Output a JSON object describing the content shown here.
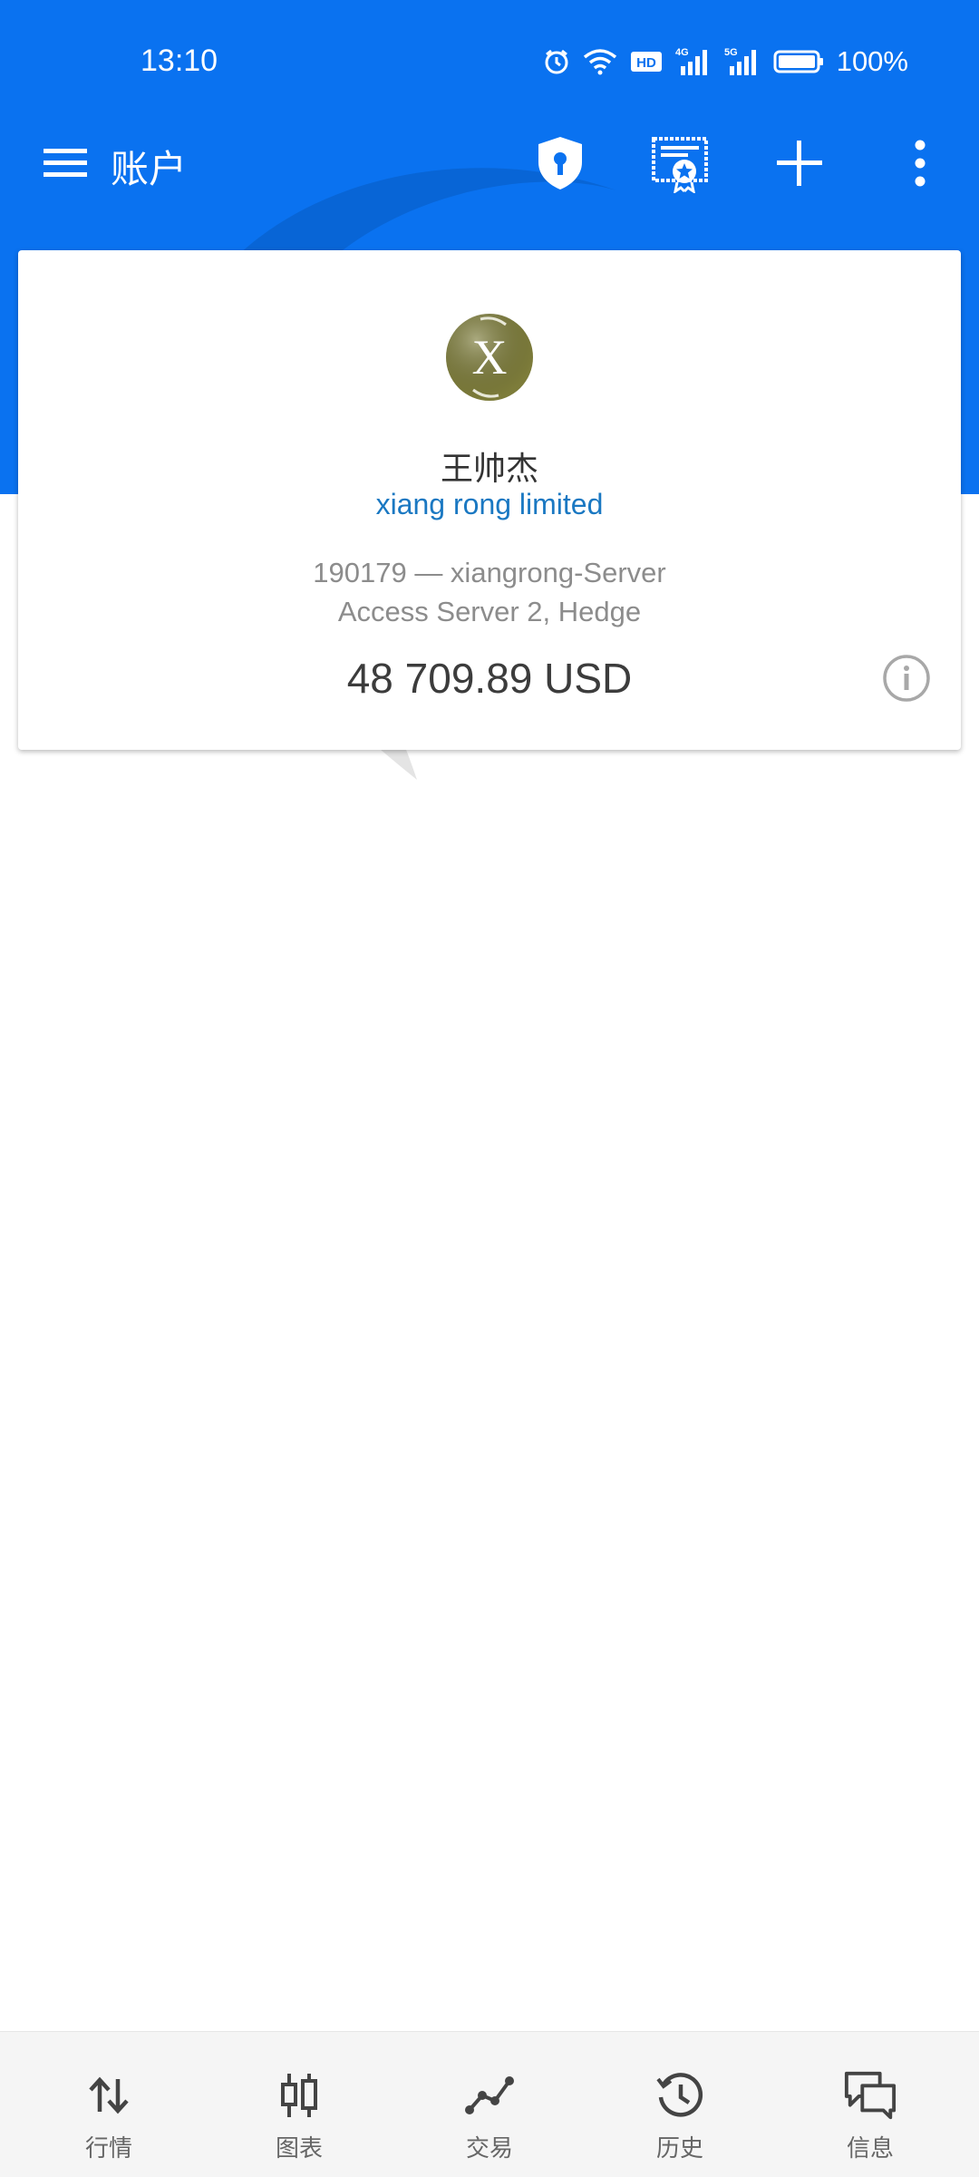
{
  "status_bar": {
    "time": "13:10",
    "battery": "100%",
    "icons": [
      "alarm-icon",
      "wifi-icon",
      "hd-icon",
      "4g-signal-icon",
      "5g-signal-icon",
      "battery-icon"
    ]
  },
  "toolbar": {
    "title": "账户",
    "icons": [
      "menu-icon",
      "shield-key-icon",
      "certificate-icon",
      "add-icon",
      "more-vert-icon"
    ]
  },
  "account": {
    "name": "王帅杰",
    "company": "xiang rong limited",
    "server": "190179 — xiangrong-Server",
    "access": "Access Server 2, Hedge",
    "balance": "48 709.89 USD",
    "logo_letter": "X"
  },
  "bottom_nav": {
    "items": [
      {
        "label": "行情",
        "icon": "quotes-arrows-icon"
      },
      {
        "label": "图表",
        "icon": "candlestick-chart-icon"
      },
      {
        "label": "交易",
        "icon": "trade-line-icon"
      },
      {
        "label": "历史",
        "icon": "history-clock-icon"
      },
      {
        "label": "信息",
        "icon": "messages-icon"
      }
    ]
  },
  "colors": {
    "primary": "#0a72f0",
    "company_link": "#1a78c2",
    "logo_bg": "#7d7c3a"
  }
}
